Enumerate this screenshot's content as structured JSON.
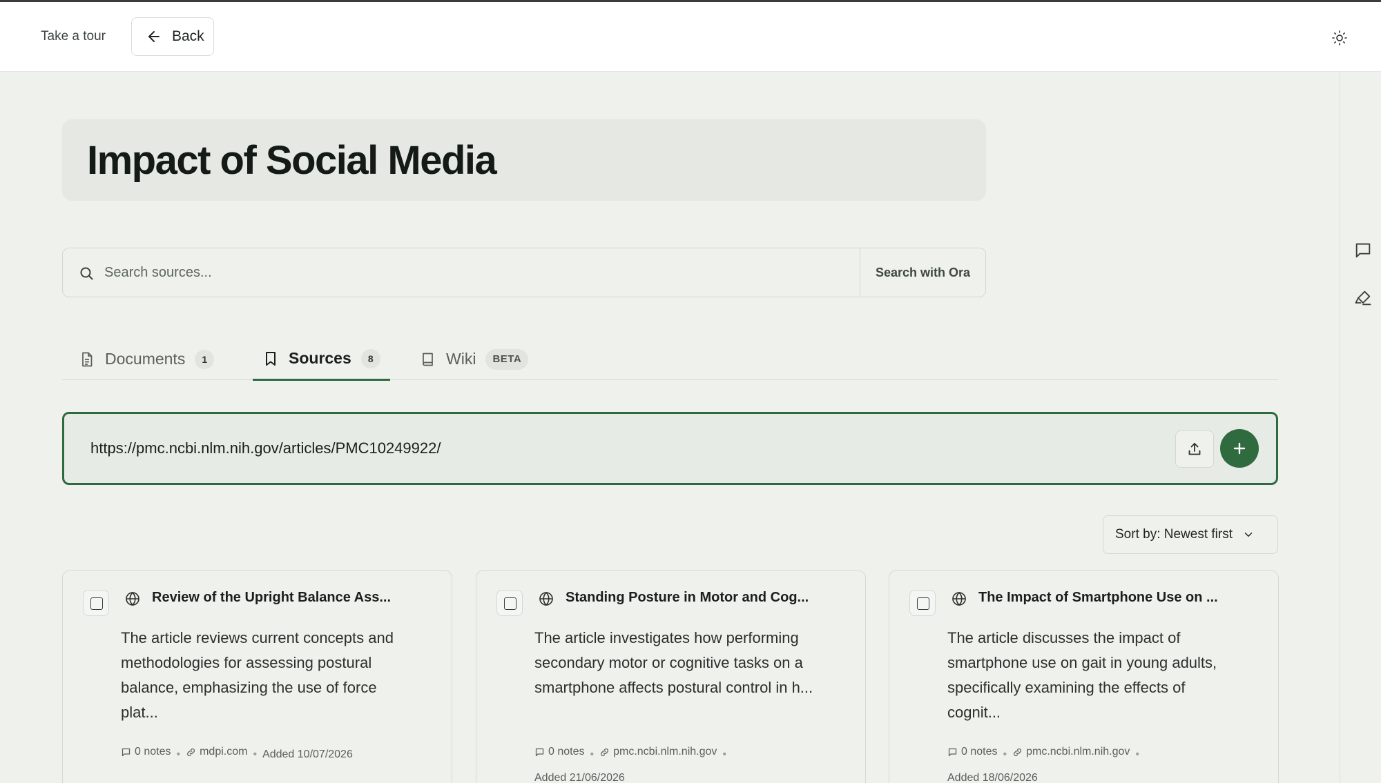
{
  "header": {
    "tour_label": "Take a tour",
    "back_label": "Back",
    "theme_icon": "sun-icon"
  },
  "rail": {
    "icons": [
      "comment-icon",
      "highlighter-icon"
    ]
  },
  "project": {
    "title": "Impact of Social Media"
  },
  "search": {
    "placeholder": "Search sources...",
    "ora_label": "Search with Ora"
  },
  "tabs": [
    {
      "label": "Documents",
      "count": "1",
      "icon": "document-icon"
    },
    {
      "label": "Sources",
      "count": "8",
      "icon": "bookmark-icon",
      "active": true
    },
    {
      "label": "Wiki",
      "badge": "BETA",
      "icon": "book-icon"
    }
  ],
  "url_input": {
    "value": "https://pmc.ncbi.nlm.nih.gov/articles/PMC10249922/"
  },
  "sort": {
    "label": "Sort by: Newest first"
  },
  "colors": {
    "accent": "#2f6b3f",
    "background": "#eef1ec"
  },
  "cards": [
    {
      "title": "Review of the Upright Balance Ass...",
      "description": "The article reviews current concepts and methodologies for assessing postural balance, emphasizing the use of force plat...",
      "notes": "0 notes",
      "domain": "mdpi.com",
      "added": "Added 10/07/2026"
    },
    {
      "title": "Standing Posture in Motor and Cog...",
      "description": "The article investigates how performing secondary motor or cognitive tasks on a smartphone affects postural control in h...",
      "notes": "0 notes",
      "domain": "pmc.ncbi.nlm.nih.gov",
      "added": "Added 21/06/2026"
    },
    {
      "title": "The Impact of Smartphone Use on ...",
      "description": "The article discusses the impact of smartphone use on gait in young adults, specifically examining the effects of cognit...",
      "notes": "0 notes",
      "domain": "pmc.ncbi.nlm.nih.gov",
      "added": "Added 18/06/2026"
    }
  ]
}
